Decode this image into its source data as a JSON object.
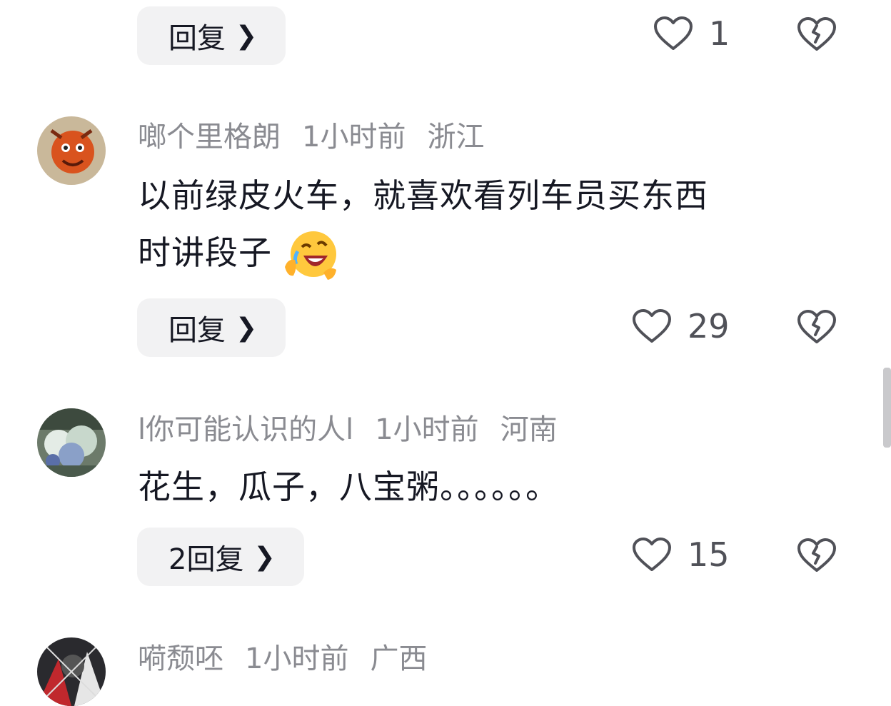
{
  "comments": [
    {
      "reply_label": "回复",
      "like_count": "1"
    },
    {
      "username": "啷个里格朗",
      "time": "1小时前",
      "location": "浙江",
      "text_line1": "以前绿皮火车，就喜欢看列车员买东西",
      "text_line2": "时讲段子",
      "emoji": "laughing-emoji",
      "reply_label": "回复",
      "like_count": "29"
    },
    {
      "username": "l你可能认识的人l",
      "time": "1小时前",
      "location": "河南",
      "text_line1": "花生，瓜子，八宝粥。。。。。。",
      "reply_label": "2回复",
      "like_count": "15"
    },
    {
      "username": "嗬颓呸",
      "time": "1小时前",
      "location": "广西"
    }
  ],
  "icons": {
    "like": "heart-outline-icon",
    "dislike": "broken-heart-icon",
    "reply_chevron": "chevron-right-icon"
  },
  "colors": {
    "meta_text": "#8a8b91",
    "button_bg": "#f2f2f3",
    "icon": "#505158"
  }
}
